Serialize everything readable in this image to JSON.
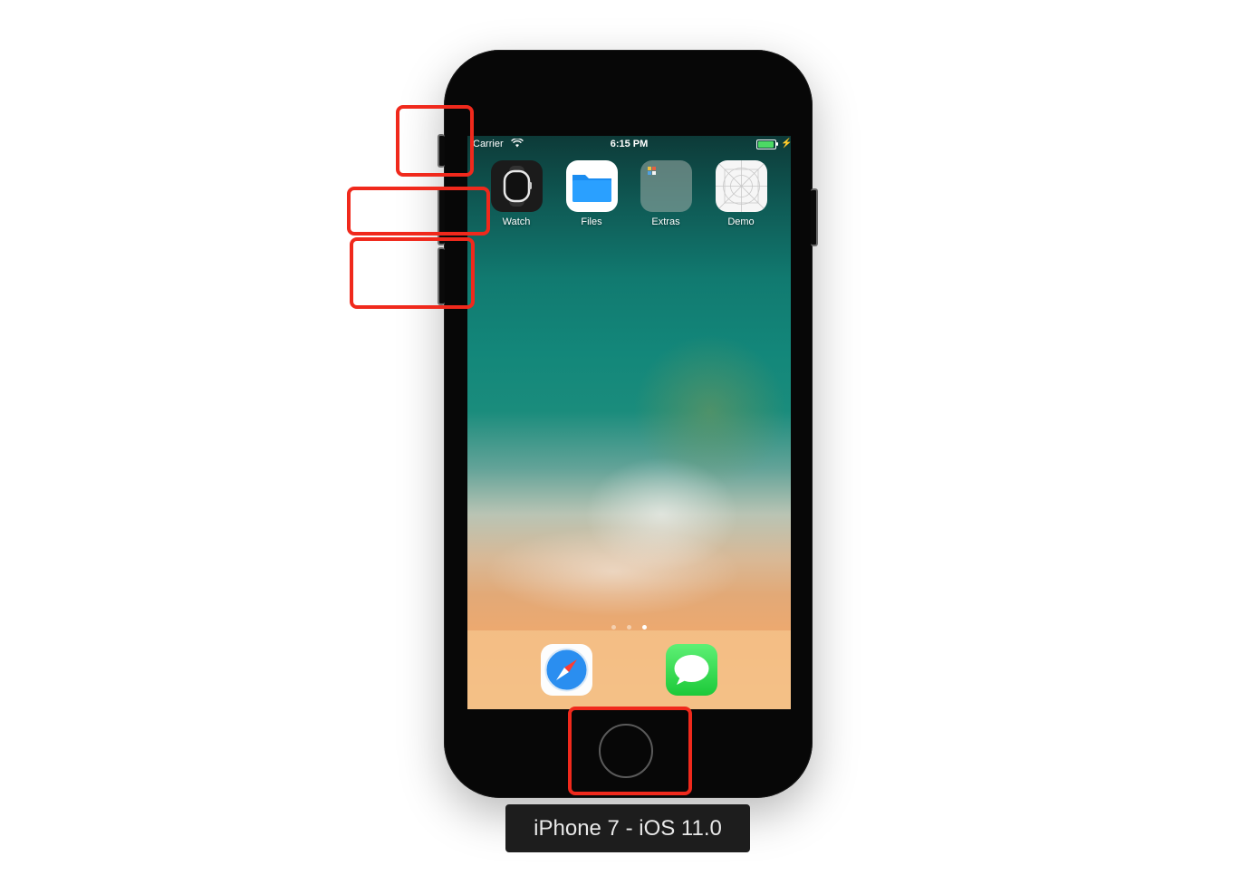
{
  "status_bar": {
    "carrier": "Carrier",
    "time": "6:15 PM"
  },
  "apps": [
    {
      "label": "Watch",
      "icon": "watch-icon"
    },
    {
      "label": "Files",
      "icon": "files-folder-icon"
    },
    {
      "label": "Extras",
      "icon": "folder-icon"
    },
    {
      "label": "Demo",
      "icon": "app-grid-icon"
    }
  ],
  "dock": [
    {
      "icon": "safari-icon"
    },
    {
      "icon": "messages-icon"
    }
  ],
  "page_indicator": {
    "pages": 3,
    "current": 3
  },
  "device_label": "iPhone 7 - iOS 11.0",
  "colors": {
    "highlight": "#f0291c",
    "battery": "#4cd964",
    "label_bg": "#1d1d1d"
  }
}
